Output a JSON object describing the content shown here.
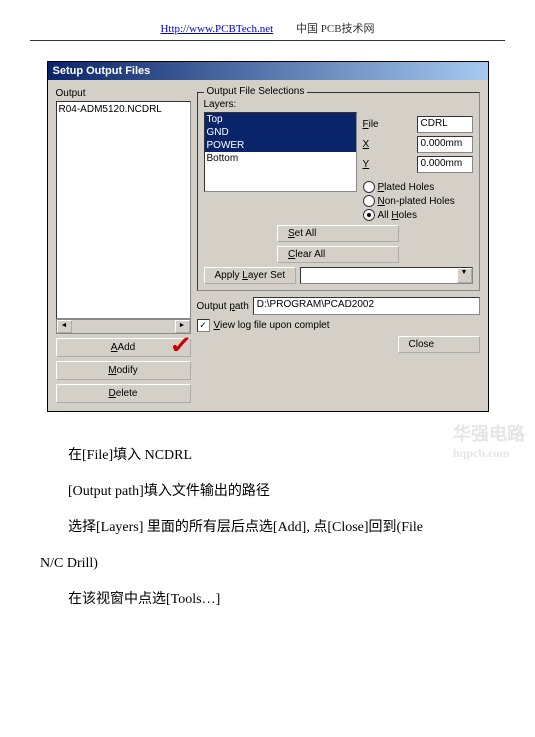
{
  "header": {
    "url": "Http://www.PCBTech.net",
    "cn": "中国 PCB技术网"
  },
  "dialog": {
    "title": "Setup Output Files",
    "outputLabel": "Output",
    "outputItem": "R04-ADM5120.NCDRL",
    "addBtn": "Add",
    "addU": "A",
    "modifyBtn": "odify",
    "modifyU": "M",
    "deleteBtn": "elete",
    "deleteU": "D",
    "selectionsLabel": "Output File Selections",
    "layersLabel": "Layers:",
    "layers": [
      "Top",
      "GND",
      "POWER",
      "Bottom"
    ],
    "fileLabel": "File",
    "fileU": "F",
    "fileVal": "CDRL",
    "xLabel": "X",
    "xU": "X",
    "xVal": "0.000mm",
    "yLabel": "Y",
    "yU": "Y",
    "yVal": "0.000mm",
    "radio1": "Plated Holes",
    "radio1U": "P",
    "radio2": "Non-plated Holes",
    "radio2U": "N",
    "radio3": "All Holes",
    "radio3U": "H",
    "setAllBtn": "Set All",
    "setAllU": "S",
    "clearAllBtn": "Clear All",
    "clearAllU": "C",
    "applyBtn": "Apply Layer Set",
    "applyU": "L",
    "pathLabel": "Output path",
    "pathU": "p",
    "pathVal": "D:\\PROGRAM\\PCAD2002",
    "viewLog": "View log file upon complet",
    "viewLogU": "V",
    "closeBtn": "Close"
  },
  "watermark": {
    "t1": "华强电路",
    "t2": "hqpcb.com"
  },
  "text": {
    "p1": "在[File]填入 NCDRL",
    "p2": "[Output path]填入文件输出的路径",
    "p3": "选择[Layers] 里面的所有层后点选[Add], 点[Close]回到(File N/C Drill)",
    "p4": "在该视窗中点选[Tools…]"
  }
}
